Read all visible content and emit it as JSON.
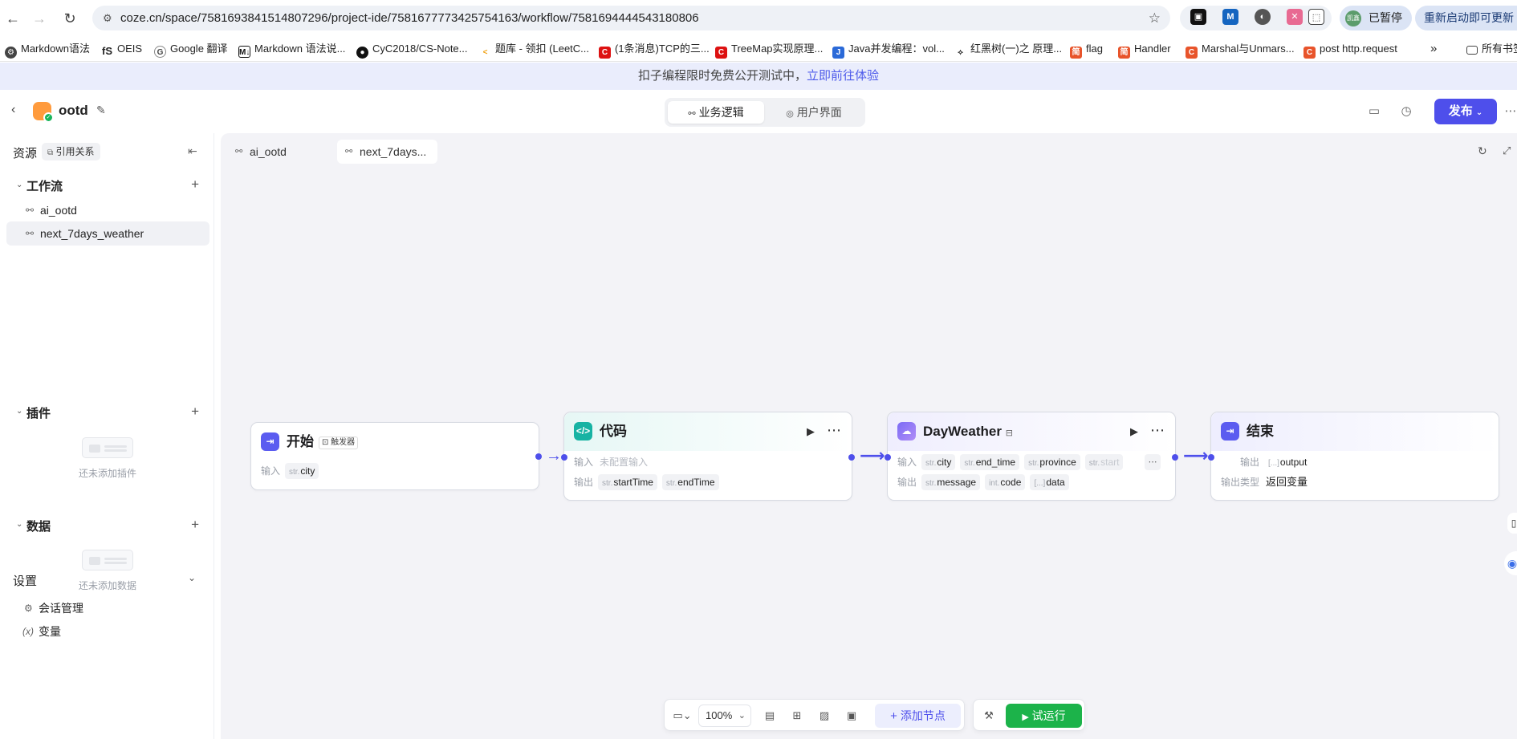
{
  "browser": {
    "url": "coze.cn/space/7581693841514807296/project-ide/7581677773425754163/workflow/7581694444543180806",
    "paused_label": "已暂停",
    "profile_initials": "凯鑫",
    "restart_label": "重新启动即可更新",
    "bookmarks": [
      "Markdown语法",
      "OEIS",
      "Google 翻译",
      "Markdown 语法说...",
      "CyC2018/CS-Note...",
      "题库 - 领扣 (LeetC...",
      "(1条消息)TCP的三...",
      "TreeMap实现原理...",
      "Java并发编程：vol...",
      "红黑树(一)之 原理...",
      "flag",
      "Handler",
      "Marshal与Unmars...",
      "post http.request"
    ],
    "more_bookmarks": "所有书签"
  },
  "banner": {
    "text": "扣子编程限时免费公开测试中，",
    "link": "立即前往体验"
  },
  "header": {
    "project_name": "ootd",
    "tabs": [
      "业务逻辑",
      "用户界面"
    ],
    "publish_label": "发布"
  },
  "sidebar": {
    "title": "资源",
    "ref_label": "引用关系",
    "workflow_section": "工作流",
    "workflows": [
      "ai_ootd",
      "next_7days_weather"
    ],
    "plugin_section": "插件",
    "plugin_empty": "还未添加插件",
    "data_section": "数据",
    "data_empty": "还未添加数据",
    "settings_section": "设置",
    "settings_items": [
      "会话管理",
      "变量"
    ]
  },
  "canvas": {
    "tabs": [
      "ai_ootd",
      "next_7days..."
    ],
    "nodes": {
      "start": {
        "title": "开始",
        "badge": "触发器",
        "input_label": "输入",
        "input_type": "str.",
        "input_name": "city"
      },
      "code": {
        "title": "代码",
        "input_label": "输入",
        "input_empty": "未配置输入",
        "output_label": "输出",
        "outputs": [
          {
            "t": "str.",
            "n": "startTime"
          },
          {
            "t": "str.",
            "n": "endTime"
          }
        ]
      },
      "weather": {
        "title": "DayWeather",
        "input_label": "输入",
        "inputs": [
          {
            "t": "str.",
            "n": "city"
          },
          {
            "t": "str.",
            "n": "end_time"
          },
          {
            "t": "str.",
            "n": "province"
          },
          {
            "t": "str.",
            "n": "start"
          }
        ],
        "output_label": "输出",
        "outputs": [
          {
            "t": "str.",
            "n": "message"
          },
          {
            "t": "int.",
            "n": "code"
          },
          {
            "t": "[...]",
            "n": "data"
          }
        ]
      },
      "end": {
        "title": "结束",
        "output_label": "输出",
        "output_type": "[...]",
        "output_name": "output",
        "type_label": "输出类型",
        "type_value": "返回变量"
      }
    }
  },
  "bottom_toolbar": {
    "zoom": "100%",
    "add_node": "添加节点",
    "test_run": "试运行"
  },
  "colors": {
    "accent": "#4e4feb",
    "run": "#1cb34a"
  }
}
